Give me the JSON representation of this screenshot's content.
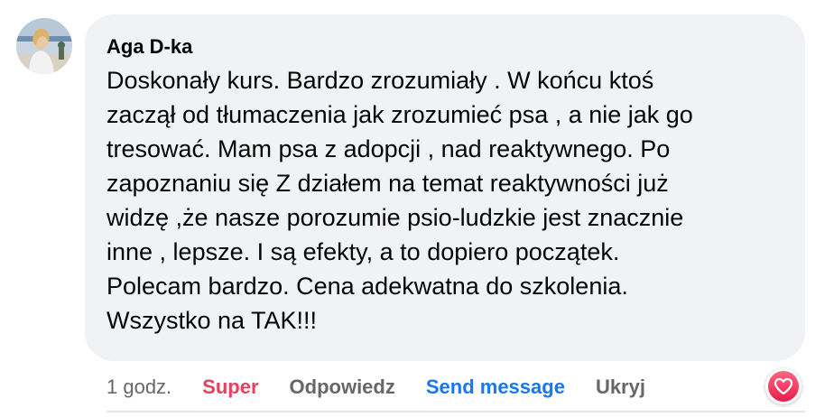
{
  "comment": {
    "author": "Aga D-ka",
    "text": "Doskonały kurs. Bardzo zrozumiały . W końcu ktoś\nzaczął od tłumaczenia jak zrozumieć psa , a nie jak go\ntresować. Mam psa z adopcji , nad reaktywnego. Po\nzapoznaniu się Z działem na temat reaktywności już\nwidzę ,że nasze porozumie psio-ludzkie jest znacznie\ninne , lepsze. I są efekty, a to dopiero początek.\nPolecam bardzo. Cena adekwatna do szkolenia.\nWszystko na TAK!!!",
    "avatar_icon": "profile-photo"
  },
  "actions": {
    "time": "1 godz.",
    "super_label": "Super",
    "reply_label": "Odpowiedz",
    "send_label": "Send message",
    "hide_label": "Ukryj"
  },
  "reaction": {
    "icon": "heart-reaction-icon",
    "color": "#e4405f"
  },
  "colors": {
    "bubble_bg": "#f0f2f5",
    "super": "#e4405f",
    "link": "#1877f2",
    "muted": "#65676b"
  }
}
